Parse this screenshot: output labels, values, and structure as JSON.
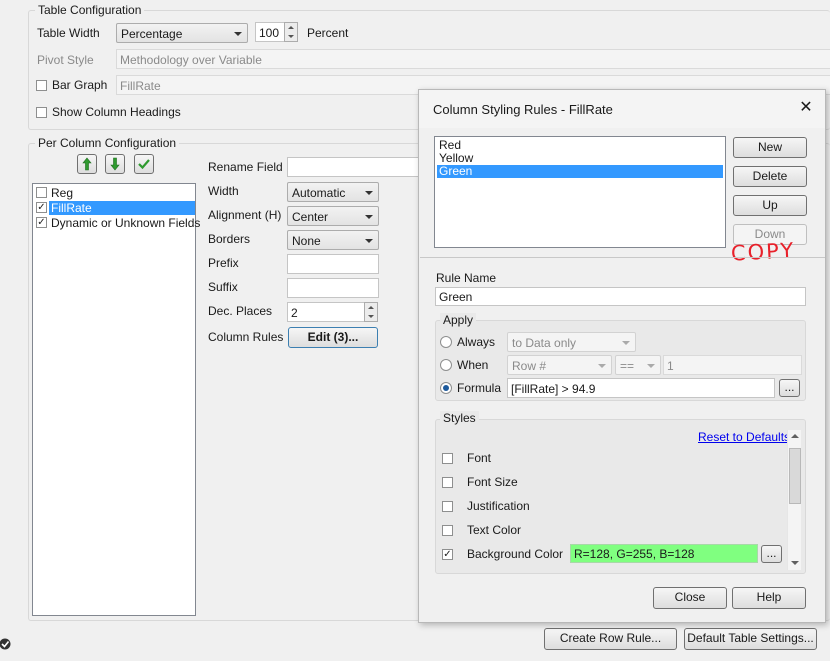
{
  "table_config": {
    "group_title": "Table Configuration",
    "table_width_label": "Table Width",
    "table_width_mode": "Percentage",
    "table_width_value": "100",
    "table_width_unit": "Percent",
    "pivot_style_label": "Pivot Style",
    "pivot_style_value": "Methodology over Variable",
    "bar_graph_label": "Bar Graph",
    "bar_graph_checked": false,
    "bar_graph_value": "FillRate",
    "show_headings_label": "Show Column Headings",
    "show_headings_checked": false
  },
  "per_column": {
    "group_title": "Per Column Configuration",
    "fields": [
      {
        "label": "Reg",
        "checked": false,
        "selected": false
      },
      {
        "label": "FillRate",
        "checked": true,
        "selected": true
      },
      {
        "label": "Dynamic or Unknown Fields",
        "checked": true,
        "selected": false
      }
    ],
    "rename_field_label": "Rename Field",
    "rename_field_value": "",
    "width_label": "Width",
    "width_value": "Automatic",
    "alignment_label": "Alignment (H)",
    "alignment_value": "Center",
    "borders_label": "Borders",
    "borders_value": "None",
    "prefix_label": "Prefix",
    "prefix_value": "",
    "suffix_label": "Suffix",
    "suffix_value": "",
    "dec_places_label": "Dec. Places",
    "dec_places_value": "2",
    "column_rules_label": "Column Rules",
    "column_rules_button": "Edit (3)..."
  },
  "bottom_buttons": {
    "create_row_rule": "Create Row Rule...",
    "default_table_settings": "Default Table Settings..."
  },
  "dialog": {
    "title": "Column Styling Rules - FillRate",
    "close_glyph": "✕",
    "rules": [
      {
        "label": "Red",
        "selected": false
      },
      {
        "label": "Yellow",
        "selected": false
      },
      {
        "label": "Green",
        "selected": true
      }
    ],
    "new_button": "New",
    "delete_button": "Delete",
    "up_button": "Up",
    "down_button": "Down",
    "handwritten_note": "COPY",
    "rule_name_label": "Rule Name",
    "rule_name_value": "Green",
    "apply": {
      "title": "Apply",
      "always_label": "Always",
      "always_option": "to Data only",
      "when_label": "When",
      "when_field": "Row #",
      "when_operator": "==",
      "when_value": "1",
      "formula_label": "Formula",
      "formula_value": "[FillRate] > 94.9",
      "formula_button": "...",
      "selected": "formula"
    },
    "styles": {
      "title": "Styles",
      "reset_link": "Reset to Defaults",
      "items": [
        {
          "label": "Font",
          "checked": false
        },
        {
          "label": "Font Size",
          "checked": false
        },
        {
          "label": "Justification",
          "checked": false
        },
        {
          "label": "Text Color",
          "checked": false
        },
        {
          "label": "Background Color",
          "checked": true
        }
      ],
      "background_value": "R=128, G=255, B=128",
      "background_color": "#80ff80",
      "background_button": "..."
    },
    "close_button": "Close",
    "help_button": "Help"
  },
  "colors": {
    "selection": "#3399ff",
    "link": "#0000ee",
    "annotation": "#e8202a",
    "arrow_green": "#2f9a2f"
  },
  "icons": {
    "move_up": "green-up-arrow-icon",
    "move_down": "green-down-arrow-icon",
    "check_all": "green-checkmark-icon",
    "status": "circle-check-icon"
  }
}
